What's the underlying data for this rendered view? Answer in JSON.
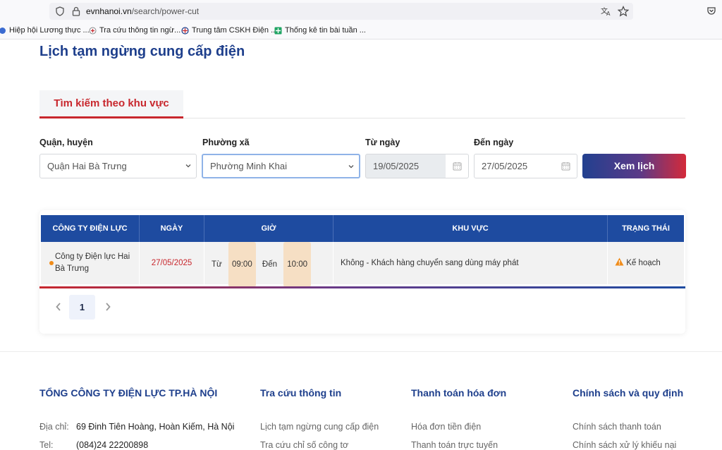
{
  "browser": {
    "url_host": "evnhanoi.vn",
    "url_path": "/search/power-cut",
    "bookmarks": [
      {
        "label": "Hiệp hội Lương thực ..."
      },
      {
        "label": "Tra cứu thông tin ngừ..."
      },
      {
        "label": "Trung tâm CSKH Điện ..."
      },
      {
        "label": "Thống kê tin bài tuần ..."
      }
    ]
  },
  "page": {
    "title": "Lịch tạm ngừng cung cấp điện"
  },
  "tabs": [
    {
      "label": "Tìm kiếm theo khu vực",
      "active": true
    }
  ],
  "form": {
    "district_label": "Quận, huyện",
    "district_value": "Quận Hai Bà Trưng",
    "ward_label": "Phường xã",
    "ward_value": "Phường Minh Khai",
    "from_label": "Từ ngày",
    "from_value": "19/05/2025",
    "to_label": "Đến ngày",
    "to_value": "27/05/2025",
    "submit_label": "Xem lịch"
  },
  "table": {
    "headers": [
      "CÔNG TY ĐIỆN LỰC",
      "NGÀY",
      "GIỜ",
      "KHU VỰC",
      "TRẠNG THÁI"
    ],
    "rows": [
      {
        "company": "Công ty Điện lực Hai Bà Trưng",
        "date": "27/05/2025",
        "from_label": "Từ",
        "from_time": "09:00",
        "to_label": "Đến",
        "to_time": "10:00",
        "area": "Không - Khách hàng chuyển sang dùng máy phát",
        "status": "Kế hoạch"
      }
    ]
  },
  "pagination": {
    "current": "1"
  },
  "footer": {
    "company_title": "TỔNG CÔNG TY ĐIỆN LỰC TP.HÀ NỘI",
    "address_label": "Địa chỉ:",
    "address_value": "69 Đinh Tiên Hoàng, Hoàn Kiếm, Hà Nội",
    "phone_label": "Tel:",
    "phone_value": "(084)24 22200898",
    "col2_title": "Tra cứu thông tin",
    "col2_links": [
      "Lịch tạm ngừng cung cấp điện",
      "Tra cứu chỉ số công tơ"
    ],
    "col3_title": "Thanh toán hóa đơn",
    "col3_links": [
      "Hóa đơn tiền điện",
      "Thanh toán trực tuyến"
    ],
    "col4_title": "Chính sách và quy định",
    "col4_links": [
      "Chính sách thanh toán",
      "Chính sách xử lý khiếu nại"
    ]
  },
  "colors": {
    "brand_blue": "#1e3f8c",
    "brand_red": "#c8272d",
    "table_header": "#1e4ba0",
    "date_red": "#c8272d",
    "status_warning": "#f08c1a"
  }
}
